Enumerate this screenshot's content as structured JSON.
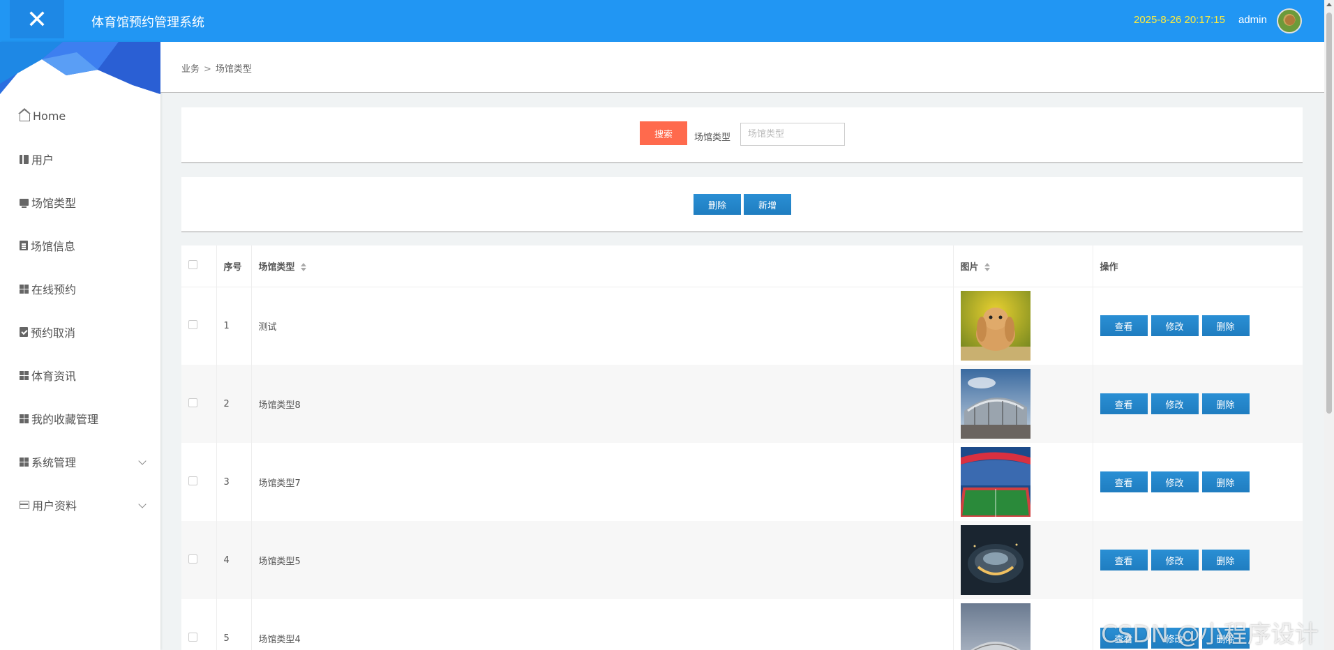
{
  "header": {
    "close_label": "✕",
    "title": "体育馆预约管理系统",
    "datetime": "2025-8-26 20:17:15",
    "username": "admin"
  },
  "sidebar": {
    "items": [
      {
        "label": "Home",
        "icon": "home-icon"
      },
      {
        "label": "用户",
        "icon": "book-icon"
      },
      {
        "label": "场馆类型",
        "icon": "monitor-icon"
      },
      {
        "label": "场馆信息",
        "icon": "clipboard-icon"
      },
      {
        "label": "在线预约",
        "icon": "grid-icon"
      },
      {
        "label": "预约取消",
        "icon": "clipboard-check-icon"
      },
      {
        "label": "体育资讯",
        "icon": "grid-icon"
      },
      {
        "label": "我的收藏管理",
        "icon": "grid-icon"
      },
      {
        "label": "系统管理",
        "icon": "grid-icon",
        "expandable": true
      },
      {
        "label": "用户资料",
        "icon": "card-icon",
        "expandable": true
      }
    ]
  },
  "breadcrumb": {
    "first": "业务",
    "separator": ">",
    "current": "场馆类型"
  },
  "search": {
    "button_label": "搜索",
    "field_label": "场馆类型",
    "placeholder": "场馆类型",
    "value": ""
  },
  "actions": {
    "delete_label": "删除",
    "add_label": "新增"
  },
  "table": {
    "columns": {
      "index": "序号",
      "type": "场馆类型",
      "image": "图片",
      "ops": "操作"
    },
    "row_buttons": {
      "view": "查看",
      "edit": "修改",
      "delete": "删除"
    },
    "rows": [
      {
        "index": "1",
        "type": "测试",
        "image": "rabbit-photo"
      },
      {
        "index": "2",
        "type": "场馆类型8",
        "image": "stadium-exterior-photo"
      },
      {
        "index": "3",
        "type": "场馆类型7",
        "image": "stadium-interior-photo"
      },
      {
        "index": "4",
        "type": "场馆类型5",
        "image": "arena-night-photo"
      },
      {
        "index": "5",
        "type": "场馆类型4",
        "image": "stadium-photo"
      }
    ]
  },
  "watermark": "CSDN @小程序设计",
  "colors": {
    "header_bg": "#2196f3",
    "datetime": "#ffeb3b",
    "search_button": "#ff6a4d",
    "primary_button": "#1f7dc0"
  }
}
